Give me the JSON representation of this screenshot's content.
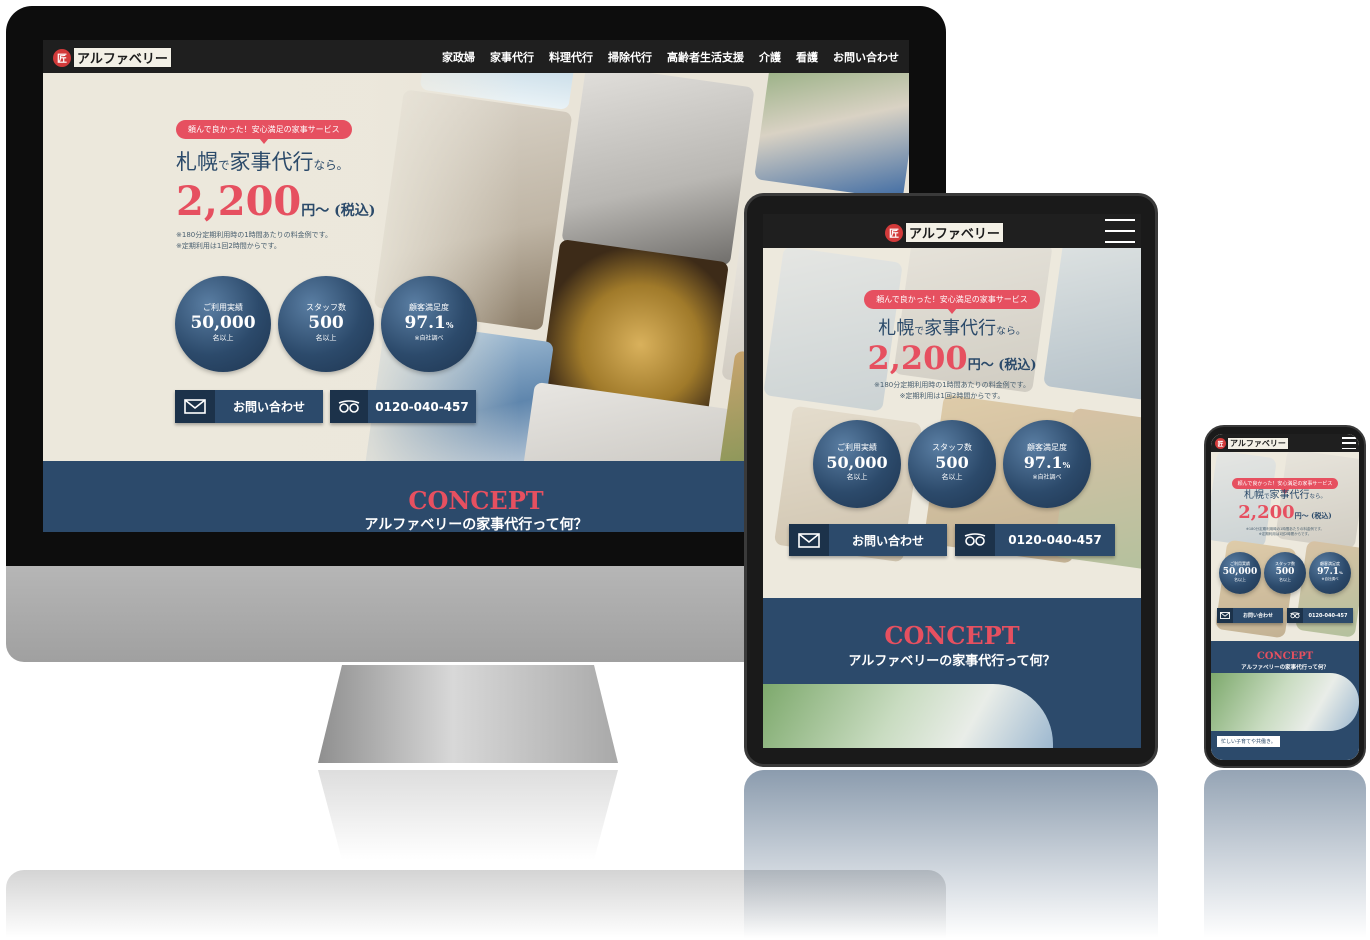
{
  "site": {
    "logo_mark": "匠",
    "logo_text": "アルファベリー"
  },
  "nav": {
    "items": [
      "家政婦",
      "家事代行",
      "料理代行",
      "掃除代行",
      "高齢者生活支援",
      "介護",
      "看護",
      "お問い合わせ"
    ]
  },
  "hero": {
    "badge": "頼んで良かった！安心満足の家事サービス",
    "headline_main_1": "札幌",
    "headline_small_1": "で",
    "headline_main_2": "家事代行",
    "headline_small_2": "なら。",
    "price": "2,200",
    "price_unit": "円～ (税込)",
    "note_1": "※180分定期利用時の1時間あたりの料金例です。",
    "note_2": "※定期利用は1回2時間からです。"
  },
  "stats": [
    {
      "label": "ご利用実績",
      "value": "50,000",
      "sub": "名以上"
    },
    {
      "label": "スタッフ数",
      "value": "500",
      "sub": "名以上"
    },
    {
      "label": "顧客満足度",
      "value": "97.1",
      "value_suffix": "%",
      "sub": "※自社調べ"
    }
  ],
  "cta": {
    "contact_label": "お問い合わせ",
    "phone_label": "0120-040-457"
  },
  "concept": {
    "title": "CONCEPT",
    "subtitle": "アルファベリーの家事代行って何？"
  },
  "phone_snippets": {
    "line_1": "忙しい子育てや共働き。",
    "line_2": "忙しい子育てや共働き。"
  },
  "colors": {
    "accent_red": "#e65060",
    "navy": "#2c4a6b",
    "nav_bg": "#1f1f1f",
    "hero_bg": "#e9e4d8"
  }
}
